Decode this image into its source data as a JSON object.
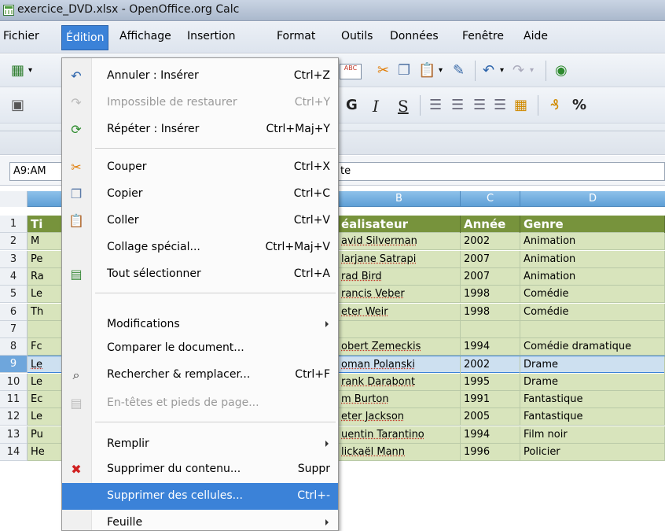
{
  "window": {
    "title": "exercice_DVD.xlsx - OpenOffice.org Calc"
  },
  "menubar": [
    {
      "label": "Fichier",
      "active": false
    },
    {
      "label": "Édition",
      "active": true
    },
    {
      "label": "Affichage",
      "active": false
    },
    {
      "label": "Insertion",
      "active": false
    },
    {
      "label": "Format",
      "active": false
    },
    {
      "label": "Outils",
      "active": false
    },
    {
      "label": "Données",
      "active": false
    },
    {
      "label": "Fenêtre",
      "active": false
    },
    {
      "label": "Aide",
      "active": false
    }
  ],
  "toolbar": {
    "bold": "G",
    "italic": "I",
    "underline": "S",
    "percent": "%",
    "spell_label": "ABC"
  },
  "formula": {
    "namebox": "A9:AM",
    "value": "te"
  },
  "columns": [
    "B",
    "C",
    "D"
  ],
  "rows": [
    {
      "num": "1",
      "a": "Ti",
      "b": "éalisateur",
      "c": "Année",
      "d": "Genre",
      "kind": "header"
    },
    {
      "num": "2",
      "a": "M",
      "b": "avid Silverman",
      "c": "2002",
      "d": "Animation",
      "kind": "normal"
    },
    {
      "num": "3",
      "a": "Pe",
      "b": "larjane Satrapi",
      "c": "2007",
      "d": "Animation",
      "kind": "normal"
    },
    {
      "num": "4",
      "a": "Ra",
      "b": "rad Bird",
      "c": "2007",
      "d": "Animation",
      "kind": "normal"
    },
    {
      "num": "5",
      "a": "Le",
      "b": "rancis Veber",
      "c": "1998",
      "d": "Comédie",
      "kind": "normal"
    },
    {
      "num": "6",
      "a": "Th",
      "b": "eter Weir",
      "c": "1998",
      "d": "Comédie",
      "kind": "normal"
    },
    {
      "num": "7",
      "a": "",
      "b": "",
      "c": "",
      "d": "",
      "kind": "normal"
    },
    {
      "num": "8",
      "a": "Fc",
      "b": "obert Zemeckis",
      "c": "1994",
      "d": "Comédie dramatique",
      "kind": "normal"
    },
    {
      "num": "9",
      "a": "Le",
      "b": "oman Polanski",
      "c": "2002",
      "d": "Drame",
      "kind": "sel"
    },
    {
      "num": "10",
      "a": "Le",
      "b": "rank Darabont",
      "c": "1995",
      "d": "Drame",
      "kind": "normal"
    },
    {
      "num": "11",
      "a": "Ec",
      "b": "m Burton",
      "c": "1991",
      "d": "Fantastique",
      "kind": "normal"
    },
    {
      "num": "12",
      "a": "Le",
      "b": "eter Jackson",
      "c": "2005",
      "d": "Fantastique",
      "kind": "normal"
    },
    {
      "num": "13",
      "a": "Pu",
      "b": "uentin Tarantino",
      "c": "1994",
      "d": "Film noir",
      "kind": "normal"
    },
    {
      "num": "14",
      "a": "He",
      "b": "lickaël Mann",
      "c": "1996",
      "d": "Policier",
      "kind": "normal"
    }
  ],
  "edit_menu": {
    "undo": {
      "label": "Annuler : Insérer",
      "shortcut": "Ctrl+Z"
    },
    "redo": {
      "label": "Impossible de restaurer",
      "shortcut": "Ctrl+Y"
    },
    "repeat": {
      "label": "Répéter : Insérer",
      "shortcut": "Ctrl+Maj+Y"
    },
    "cut": {
      "label": "Couper",
      "shortcut": "Ctrl+X"
    },
    "copy": {
      "label": "Copier",
      "shortcut": "Ctrl+C"
    },
    "paste": {
      "label": "Coller",
      "shortcut": "Ctrl+V"
    },
    "paste_special": {
      "label": "Collage spécial...",
      "shortcut": "Ctrl+Maj+V"
    },
    "select_all": {
      "label": "Tout sélectionner",
      "shortcut": "Ctrl+A"
    },
    "changes": {
      "label": "Modifications"
    },
    "compare": {
      "label": "Comparer le document..."
    },
    "find_replace": {
      "label": "Rechercher & remplacer...",
      "shortcut": "Ctrl+F"
    },
    "headers_footers": {
      "label": "En-têtes et pieds de page..."
    },
    "fill": {
      "label": "Remplir"
    },
    "delete_contents": {
      "label": "Supprimer du contenu...",
      "shortcut": "Suppr"
    },
    "delete_cells": {
      "label": "Supprimer des cellules...",
      "shortcut": "Ctrl+-"
    },
    "sheet": {
      "label": "Feuille"
    }
  }
}
